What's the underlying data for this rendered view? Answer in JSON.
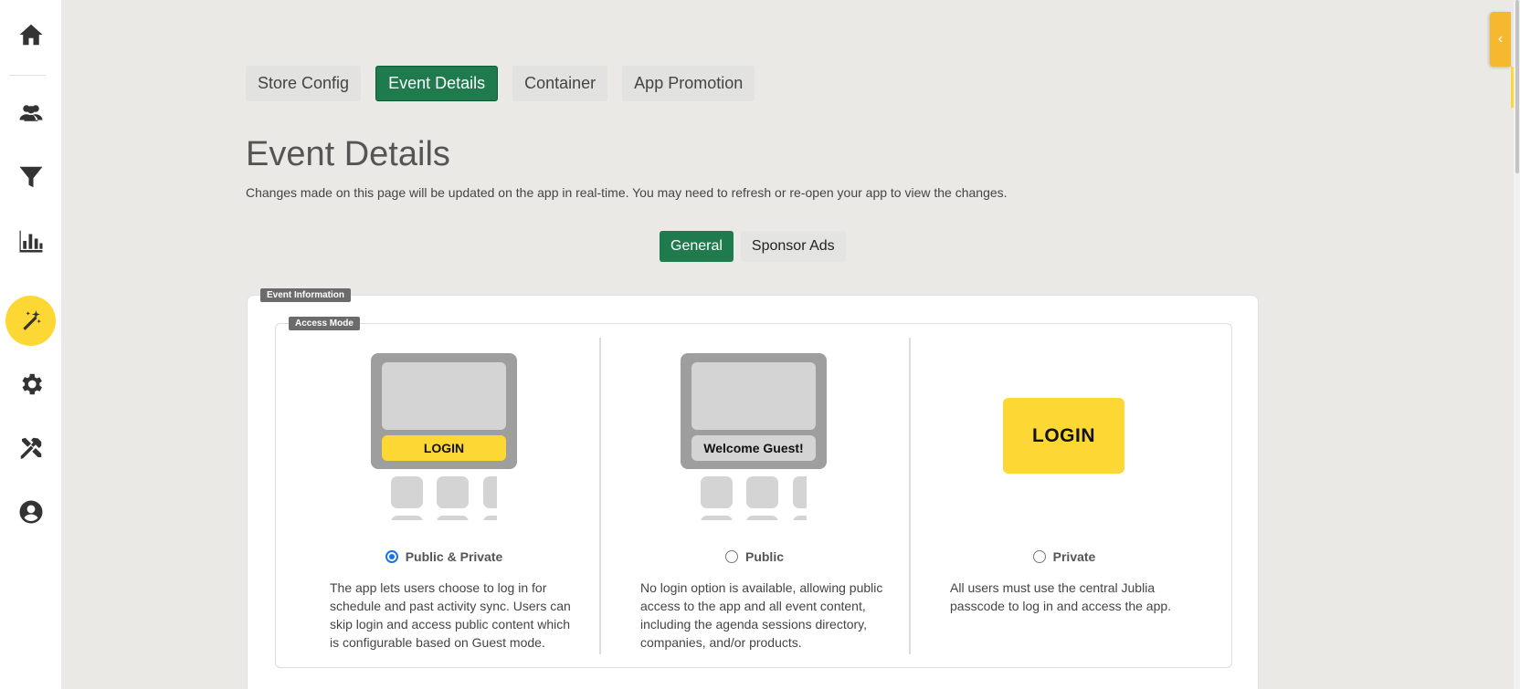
{
  "sidebar": {
    "items": [
      {
        "icon": "home-icon"
      },
      {
        "icon": "users-icon"
      },
      {
        "icon": "filter-icon"
      },
      {
        "icon": "chart-icon"
      },
      {
        "icon": "magic-wand-icon",
        "active": true
      },
      {
        "icon": "gear-icon"
      },
      {
        "icon": "tools-icon"
      },
      {
        "icon": "user-circle-icon"
      }
    ]
  },
  "top_tabs": [
    "Store Config",
    "Event Details",
    "Container",
    "App Promotion"
  ],
  "active_top_tab": "Event Details",
  "page": {
    "title": "Event Details",
    "description": "Changes made on this page will be updated on the app in real-time. You may need to refresh or re-open your app to view the changes."
  },
  "sub_tabs": [
    "General",
    "Sponsor Ads"
  ],
  "active_sub_tab": "General",
  "event_information": {
    "legend": "Event Information",
    "access_mode": {
      "legend": "Access Mode",
      "options": [
        {
          "label": "Public & Private",
          "selected": true,
          "preview_text": "LOGIN",
          "description": "The app lets users choose to log in for schedule and past activity sync. Users can skip login and access public content which is configurable based on Guest mode."
        },
        {
          "label": "Public",
          "selected": false,
          "preview_text": "Welcome Guest!",
          "description": "No login option is available, allowing public access to the app and all event content, including the agenda sessions directory, companies, and/or products."
        },
        {
          "label": "Private",
          "selected": false,
          "preview_text": "LOGIN",
          "description": "All users must use the central Jublia passcode to log in and access the app."
        }
      ]
    }
  },
  "colors": {
    "accent_green": "#1f7a4d",
    "accent_yellow": "#fdd835",
    "flyout_orange": "#f5b82e"
  }
}
